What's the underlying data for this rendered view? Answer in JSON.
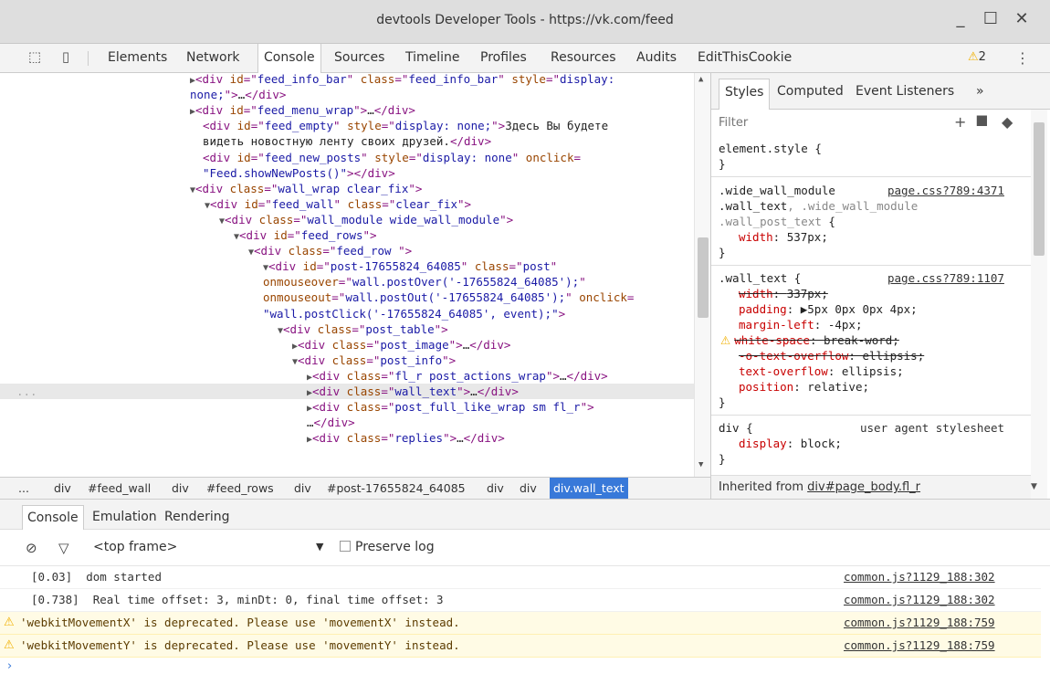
{
  "window": {
    "title": "devtools  Developer Tools - https://vk.com/feed",
    "minimize": "_",
    "maximize": "☐",
    "close": "✕"
  },
  "toolbar": {
    "inspect_icon": "⬚",
    "device_icon": "▯",
    "tabs": [
      {
        "label": "Elements"
      },
      {
        "label": "Network"
      },
      {
        "label": "Console"
      },
      {
        "label": "Sources"
      },
      {
        "label": "Timeline"
      },
      {
        "label": "Profiles"
      },
      {
        "label": "Resources"
      },
      {
        "label": "Audits"
      },
      {
        "label": "EditThisCookie"
      }
    ],
    "warning_count": "2",
    "warning_icon": "⚠",
    "more_icon": "⋮"
  },
  "elements": {
    "lines": [
      {
        "indent": 208,
        "arrow": "▶",
        "html": [
          [
            "t",
            "<div "
          ],
          [
            "an",
            "id"
          ],
          [
            "t",
            "=\""
          ],
          [
            "av",
            "feed_info_bar"
          ],
          [
            "t",
            "\" "
          ],
          [
            "an",
            "class"
          ],
          [
            "t",
            "=\""
          ],
          [
            "av",
            "feed_info_bar"
          ],
          [
            "t",
            "\" "
          ],
          [
            "an",
            "style"
          ],
          [
            "t",
            "=\""
          ],
          [
            "av",
            "display:"
          ]
        ]
      },
      {
        "indent": 208,
        "arrow": "",
        "html": [
          [
            "av",
            "none;"
          ],
          [
            "t",
            "\">"
          ],
          [
            "tx",
            "…"
          ],
          [
            "t",
            "</div>"
          ]
        ]
      },
      {
        "indent": 208,
        "arrow": "▶",
        "html": [
          [
            "t",
            "<div "
          ],
          [
            "an",
            "id"
          ],
          [
            "t",
            "=\""
          ],
          [
            "av",
            "feed_menu_wrap"
          ],
          [
            "t",
            "\">"
          ],
          [
            "tx",
            "…"
          ],
          [
            "t",
            "</div>"
          ]
        ]
      },
      {
        "indent": 222,
        "arrow": "",
        "html": [
          [
            "t",
            "<div "
          ],
          [
            "an",
            "id"
          ],
          [
            "t",
            "=\""
          ],
          [
            "av",
            "feed_empty"
          ],
          [
            "t",
            "\" "
          ],
          [
            "an",
            "style"
          ],
          [
            "t",
            "=\""
          ],
          [
            "av",
            "display: none;"
          ],
          [
            "t",
            "\">"
          ],
          [
            "tx",
            "Здесь Вы будете"
          ]
        ]
      },
      {
        "indent": 222,
        "arrow": "",
        "html": [
          [
            "tx",
            "видеть новостную ленту своих друзей."
          ],
          [
            "t",
            "</div>"
          ]
        ]
      },
      {
        "indent": 222,
        "arrow": "",
        "html": [
          [
            "t",
            "<div "
          ],
          [
            "an",
            "id"
          ],
          [
            "t",
            "=\""
          ],
          [
            "av",
            "feed_new_posts"
          ],
          [
            "t",
            "\" "
          ],
          [
            "an",
            "style"
          ],
          [
            "t",
            "=\""
          ],
          [
            "av",
            "display: none"
          ],
          [
            "t",
            "\" "
          ],
          [
            "an",
            "onclick"
          ],
          [
            "t",
            "="
          ]
        ]
      },
      {
        "indent": 222,
        "arrow": "",
        "html": [
          [
            "av",
            "\"Feed.showNewPosts()\""
          ],
          [
            "t",
            ">"
          ],
          [
            "t",
            "</div>"
          ]
        ]
      },
      {
        "indent": 208,
        "arrow": "▼",
        "html": [
          [
            "t",
            "<div "
          ],
          [
            "an",
            "class"
          ],
          [
            "t",
            "=\""
          ],
          [
            "av",
            "wall_wrap clear_fix"
          ],
          [
            "t",
            "\">"
          ]
        ]
      },
      {
        "indent": 224,
        "arrow": "▼",
        "html": [
          [
            "t",
            "<div "
          ],
          [
            "an",
            "id"
          ],
          [
            "t",
            "=\""
          ],
          [
            "av",
            "feed_wall"
          ],
          [
            "t",
            "\" "
          ],
          [
            "an",
            "class"
          ],
          [
            "t",
            "=\""
          ],
          [
            "av",
            "clear_fix"
          ],
          [
            "t",
            "\">"
          ]
        ]
      },
      {
        "indent": 240,
        "arrow": "▼",
        "html": [
          [
            "t",
            "<div "
          ],
          [
            "an",
            "class"
          ],
          [
            "t",
            "=\""
          ],
          [
            "av",
            "wall_module wide_wall_module"
          ],
          [
            "t",
            "\">"
          ]
        ]
      },
      {
        "indent": 256,
        "arrow": "▼",
        "html": [
          [
            "t",
            "<div "
          ],
          [
            "an",
            "id"
          ],
          [
            "t",
            "=\""
          ],
          [
            "av",
            "feed_rows"
          ],
          [
            "t",
            "\">"
          ]
        ]
      },
      {
        "indent": 272,
        "arrow": "▼",
        "html": [
          [
            "t",
            "<div "
          ],
          [
            "an",
            "class"
          ],
          [
            "t",
            "=\""
          ],
          [
            "av",
            "feed_row "
          ],
          [
            "t",
            "\">"
          ]
        ]
      },
      {
        "indent": 288,
        "arrow": "▼",
        "html": [
          [
            "t",
            "<div "
          ],
          [
            "an",
            "id"
          ],
          [
            "t",
            "=\""
          ],
          [
            "av",
            "post-17655824_64085"
          ],
          [
            "t",
            "\" "
          ],
          [
            "an",
            "class"
          ],
          [
            "t",
            "=\""
          ],
          [
            "av",
            "post"
          ],
          [
            "t",
            "\""
          ]
        ]
      },
      {
        "indent": 288,
        "arrow": "",
        "html": [
          [
            "an",
            "onmouseover"
          ],
          [
            "t",
            "=\""
          ],
          [
            "av",
            "wall.postOver('-17655824_64085');"
          ],
          [
            "t",
            "\""
          ]
        ]
      },
      {
        "indent": 288,
        "arrow": "",
        "html": [
          [
            "an",
            "onmouseout"
          ],
          [
            "t",
            "=\""
          ],
          [
            "av",
            "wall.postOut('-17655824_64085');"
          ],
          [
            "t",
            "\" "
          ],
          [
            "an",
            "onclick"
          ],
          [
            "t",
            "="
          ]
        ]
      },
      {
        "indent": 288,
        "arrow": "",
        "html": [
          [
            "av",
            "\"wall.postClick('-17655824_64085', event);\""
          ],
          [
            "t",
            ">"
          ]
        ]
      },
      {
        "indent": 304,
        "arrow": "▼",
        "html": [
          [
            "t",
            "<div "
          ],
          [
            "an",
            "class"
          ],
          [
            "t",
            "=\""
          ],
          [
            "av",
            "post_table"
          ],
          [
            "t",
            "\">"
          ]
        ]
      },
      {
        "indent": 320,
        "arrow": "▶",
        "html": [
          [
            "t",
            "<div "
          ],
          [
            "an",
            "class"
          ],
          [
            "t",
            "=\""
          ],
          [
            "av",
            "post_image"
          ],
          [
            "t",
            "\">"
          ],
          [
            "tx",
            "…"
          ],
          [
            "t",
            "</div>"
          ]
        ]
      },
      {
        "indent": 320,
        "arrow": "▼",
        "html": [
          [
            "t",
            "<div "
          ],
          [
            "an",
            "class"
          ],
          [
            "t",
            "=\""
          ],
          [
            "av",
            "post_info"
          ],
          [
            "t",
            "\">"
          ]
        ]
      },
      {
        "indent": 336,
        "arrow": "▶",
        "html": [
          [
            "t",
            "<div "
          ],
          [
            "an",
            "class"
          ],
          [
            "t",
            "=\""
          ],
          [
            "av",
            "fl_r post_actions_wrap"
          ],
          [
            "t",
            "\">"
          ],
          [
            "tx",
            "…"
          ],
          [
            "t",
            "</div>"
          ]
        ]
      },
      {
        "indent": 336,
        "arrow": "▶",
        "selected": true,
        "html": [
          [
            "t",
            "<div "
          ],
          [
            "an",
            "class"
          ],
          [
            "t",
            "=\""
          ],
          [
            "av",
            "wall_text"
          ],
          [
            "t",
            "\">"
          ],
          [
            "tx",
            "…"
          ],
          [
            "t",
            "</div>"
          ]
        ]
      },
      {
        "indent": 336,
        "arrow": "▶",
        "html": [
          [
            "t",
            "<div "
          ],
          [
            "an",
            "class"
          ],
          [
            "t",
            "=\""
          ],
          [
            "av",
            "post_full_like_wrap sm fl_r"
          ],
          [
            "t",
            "\">"
          ]
        ]
      },
      {
        "indent": 336,
        "arrow": "",
        "html": [
          [
            "tx",
            "…"
          ],
          [
            "t",
            "</div>"
          ]
        ]
      },
      {
        "indent": 336,
        "arrow": "▶",
        "html": [
          [
            "t",
            "<div "
          ],
          [
            "an",
            "class"
          ],
          [
            "t",
            "=\""
          ],
          [
            "av",
            "replies"
          ],
          [
            "t",
            "\">"
          ],
          [
            "tx",
            "…"
          ],
          [
            "t",
            "</div>"
          ]
        ]
      }
    ],
    "selected_marker": "..."
  },
  "breadcrumbs": [
    {
      "label": "..."
    },
    {
      "label": "div"
    },
    {
      "label": "#feed_wall"
    },
    {
      "label": "div"
    },
    {
      "label": "#feed_rows"
    },
    {
      "label": "div"
    },
    {
      "label": "#post-17655824_64085"
    },
    {
      "label": "div"
    },
    {
      "label": "div"
    },
    {
      "label": "div.wall_text",
      "selected": true
    }
  ],
  "styles": {
    "tabs": [
      {
        "label": "Styles"
      },
      {
        "label": "Computed"
      },
      {
        "label": "Event Listeners"
      },
      {
        "label": "»"
      }
    ],
    "filter_placeholder": "Filter",
    "add_rule_icon": "+",
    "pin_icon": "⯆",
    "toggle_icon": "◆",
    "rules": [
      {
        "selector": "element.style {",
        "close": "}"
      },
      {
        "selector_line1": ".wide_wall_module",
        "source": "page.css?789:4371",
        "selector_line2a": ".wall_text",
        "selector_line2b": ", .wide_wall_module",
        "selector_line3": ".wall_post_text",
        "brace": " {",
        "props": [
          {
            "name": "width",
            "value": "537px;"
          }
        ],
        "close": "}"
      },
      {
        "selector": ".wall_text {",
        "source": "page.css?789:1107",
        "props": [
          {
            "name": "width",
            "value": "337px;",
            "struck": true
          },
          {
            "name": "padding",
            "value": "▶5px 0px 0px 4px;"
          },
          {
            "name": "margin-left",
            "value": "-4px;"
          },
          {
            "name": "white-space",
            "value": "break-word;",
            "struck": true,
            "warning": true
          },
          {
            "name": "-o-text-overflow",
            "value": "ellipsis;",
            "struck": true
          },
          {
            "name": "text-overflow",
            "value": "ellipsis;"
          },
          {
            "name": "position",
            "value": "relative;"
          }
        ],
        "close": "}"
      },
      {
        "selector": "div {",
        "source": "user agent stylesheet",
        "props": [
          {
            "name": "display",
            "value": "block;"
          }
        ],
        "close": "}"
      }
    ],
    "inherited_label": "Inherited from ",
    "inherited_link": "div#page_body.fl_r"
  },
  "drawer": {
    "tabs": [
      {
        "label": "Console"
      },
      {
        "label": "Emulation"
      },
      {
        "label": "Rendering"
      }
    ],
    "clear_icon": "⊘",
    "filter_icon": "▽",
    "frame": "<top frame>",
    "frame_arrow": "▼",
    "preserve_log": "Preserve log",
    "messages": [
      {
        "text": "[0.03]  dom started",
        "source": "common.js?1129_188:302",
        "warn": false
      },
      {
        "text": "[0.738]  Real time offset: 3, minDt: 0, final time offset: 3",
        "source": "common.js?1129_188:302",
        "warn": false
      },
      {
        "text": "'webkitMovementX' is deprecated. Please use 'movementX' instead.",
        "source": "common.js?1129_188:759",
        "warn": true
      },
      {
        "text": "'webkitMovementY' is deprecated. Please use 'movementY' instead.",
        "source": "common.js?1129_188:759",
        "warn": true
      }
    ],
    "prompt": "›"
  }
}
